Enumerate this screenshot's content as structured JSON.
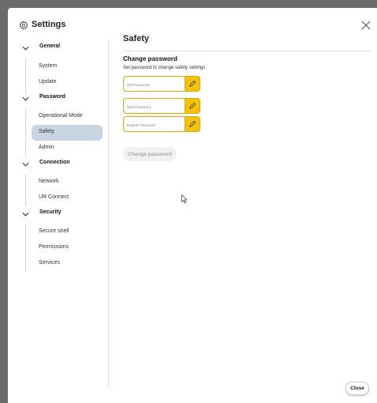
{
  "app": {
    "title": "Settings",
    "close_icon": "close-x-icon"
  },
  "sidebar": {
    "groups": [
      {
        "label": "General",
        "icon": "chevron-down-icon",
        "items": [
          {
            "label": "System"
          },
          {
            "label": "Update"
          }
        ]
      },
      {
        "label": "Password",
        "icon": "chevron-down-icon",
        "items": [
          {
            "label": "Operational Mode"
          },
          {
            "label": "Safety",
            "selected": true
          },
          {
            "label": "Admin"
          }
        ]
      },
      {
        "label": "Connection",
        "icon": "chevron-down-icon",
        "items": [
          {
            "label": "Network"
          },
          {
            "label": "UR Connect"
          }
        ]
      },
      {
        "label": "Security",
        "icon": "chevron-down-icon",
        "items": [
          {
            "label": "Secure shell"
          },
          {
            "label": "Permissions"
          },
          {
            "label": "Services"
          }
        ]
      }
    ]
  },
  "main": {
    "title": "Safety",
    "section_title": "Change password",
    "section_desc": "Set password to change safety settings",
    "fields": [
      {
        "placeholder": "Old Password",
        "icon": "pencil-icon"
      },
      {
        "placeholder": "New Password",
        "icon": "pencil-icon"
      },
      {
        "placeholder": "Repeat Password",
        "icon": "pencil-icon"
      }
    ],
    "change_button": "Change password"
  },
  "footer": {
    "close_label": "Close"
  },
  "colors": {
    "accent": "#f4c20d",
    "accent_border": "#e0a800",
    "selected_bg": "#c9d5e3"
  }
}
